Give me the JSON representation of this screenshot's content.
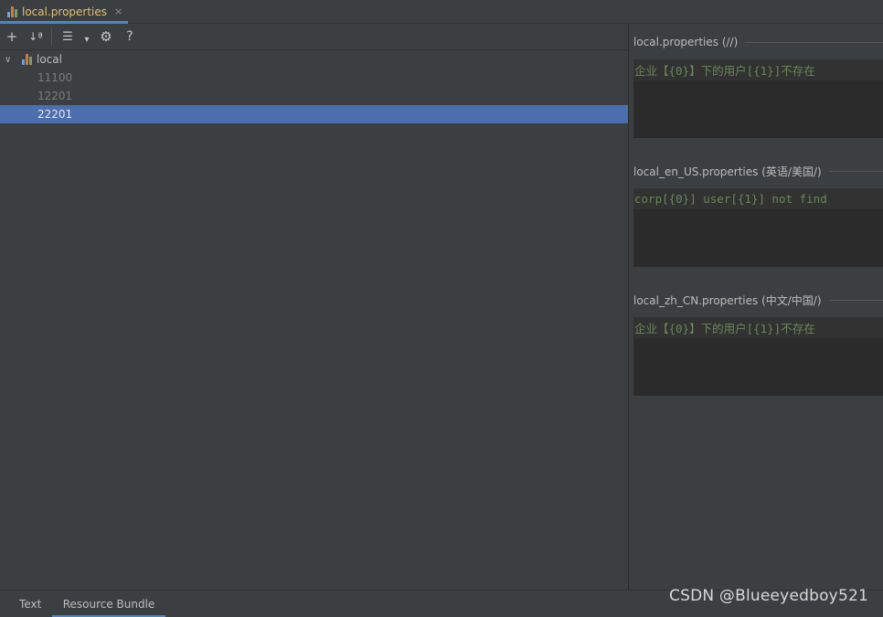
{
  "tab": {
    "label": "local.properties",
    "close": "×",
    "icon": "resource-bundle-icon"
  },
  "toolbar": {
    "add": "+",
    "sort": "↓ª",
    "group": "☰",
    "dropdown": "▾",
    "settings": "⚙",
    "help": "?"
  },
  "tree": {
    "root": {
      "label": "local",
      "chevron": "∨"
    },
    "items": [
      {
        "label": "11100"
      },
      {
        "label": "12201"
      },
      {
        "label": "22201",
        "selected": true
      }
    ]
  },
  "sections": [
    {
      "header": "local.properties (//)",
      "value": "企业【{0}】下的用户[{1}]不存在"
    },
    {
      "header": "local_en_US.properties (英语/美国/)",
      "value": "corp[{0}] user[{1}] not find"
    },
    {
      "header": "local_zh_CN.properties (中文/中国/)",
      "value": "企业【{0}】下的用户[{1}]不存在"
    }
  ],
  "bottom_tabs": [
    {
      "label": "Text"
    },
    {
      "label": "Resource Bundle",
      "active": true
    }
  ],
  "watermark": "CSDN @Blueeyedboy521",
  "colors": {
    "background": "#3c3f41",
    "selection": "#4b6eaf",
    "accent": "#4a88c7",
    "string_green": "#6a8759",
    "tab_text": "#e3c16b"
  }
}
